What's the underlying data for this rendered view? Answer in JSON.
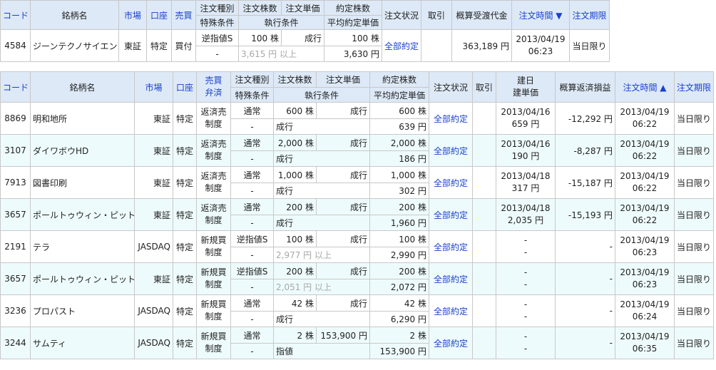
{
  "top": {
    "headers": {
      "code": "コード",
      "name": "銘柄名",
      "market": "市場",
      "account": "口座",
      "side": "売買",
      "order_type": "注文種別",
      "special": "特殊条件",
      "qty": "注文株数",
      "price": "注文単価",
      "exec_cond": "執行条件",
      "filled_qty": "約定株数",
      "avg_price": "平均約定単価",
      "status": "注文状況",
      "trade": "取引",
      "amount": "概算受渡代金",
      "order_time": "注文時間 ▼",
      "expiry": "注文期限"
    },
    "row": {
      "code": "4584",
      "name": "ジーンテクノサイエンス",
      "market": "東証",
      "account": "特定",
      "side": "買付",
      "order_type": "逆指値S",
      "special": "-",
      "qty": "100 株",
      "price": "成行",
      "exec": "3,615 円 以上",
      "filled_qty": "100 株",
      "avg_price": "3,630 円",
      "status": "全部約定",
      "trade": "",
      "amount": "363,189 円",
      "time1": "2013/04/19",
      "time2": "06:23",
      "expiry": "当日限り"
    }
  },
  "bottom": {
    "headers": {
      "code": "コード",
      "name": "銘柄名",
      "market": "市場",
      "account": "口座",
      "side1": "売買",
      "side2": "弁済",
      "order_type": "注文種別",
      "special": "特殊条件",
      "qty": "注文株数",
      "price": "注文単価",
      "exec_cond": "執行条件",
      "filled_qty": "約定株数",
      "avg_price": "平均約定単価",
      "status": "注文状況",
      "trade": "取引",
      "build1": "建日",
      "build2": "建単価",
      "pnl": "概算返済損益",
      "order_time": "注文時間 ▲",
      "expiry": "注文期限"
    },
    "rows": [
      {
        "code": "8869",
        "name": "明和地所",
        "market": "東証",
        "account": "特定",
        "side1": "返済売",
        "side2": "制度",
        "order_type": "通常",
        "special": "-",
        "qty": "600 株",
        "price": "成行",
        "exec": "成行",
        "exec_gray": false,
        "filled": "600 株",
        "avg": "639 円",
        "status": "全部約定",
        "build_date": "2013/04/16",
        "build_price": "659 円",
        "pnl": "-12,292 円",
        "time1": "2013/04/19",
        "time2": "06:22",
        "expiry": "当日限り"
      },
      {
        "code": "3107",
        "name": "ダイワボウHD",
        "market": "東証",
        "account": "特定",
        "side1": "返済売",
        "side2": "制度",
        "order_type": "通常",
        "special": "-",
        "qty": "2,000 株",
        "price": "成行",
        "exec": "成行",
        "exec_gray": false,
        "filled": "2,000 株",
        "avg": "186 円",
        "status": "全部約定",
        "build_date": "2013/04/16",
        "build_price": "190 円",
        "pnl": "-8,287 円",
        "time1": "2013/04/19",
        "time2": "06:22",
        "expiry": "当日限り"
      },
      {
        "code": "7913",
        "name": "図書印刷",
        "market": "東証",
        "account": "特定",
        "side1": "返済売",
        "side2": "制度",
        "order_type": "通常",
        "special": "-",
        "qty": "1,000 株",
        "price": "成行",
        "exec": "成行",
        "exec_gray": false,
        "filled": "1,000 株",
        "avg": "302 円",
        "status": "全部約定",
        "build_date": "2013/04/18",
        "build_price": "317 円",
        "pnl": "-15,187 円",
        "time1": "2013/04/19",
        "time2": "06:22",
        "expiry": "当日限り"
      },
      {
        "code": "3657",
        "name": "ポールトゥウィン・ピットクル",
        "market": "東証",
        "account": "特定",
        "side1": "返済売",
        "side2": "制度",
        "order_type": "通常",
        "special": "-",
        "qty": "200 株",
        "price": "成行",
        "exec": "成行",
        "exec_gray": false,
        "filled": "200 株",
        "avg": "1,960 円",
        "status": "全部約定",
        "build_date": "2013/04/18",
        "build_price": "2,035 円",
        "pnl": "-15,193 円",
        "time1": "2013/04/19",
        "time2": "06:22",
        "expiry": "当日限り"
      },
      {
        "code": "2191",
        "name": "テラ",
        "market": "JASDAQ",
        "account": "特定",
        "side1": "新規買",
        "side2": "制度",
        "order_type": "逆指値S",
        "special": "-",
        "qty": "100 株",
        "price": "成行",
        "exec": "2,977 円 以上",
        "exec_gray": true,
        "filled": "100 株",
        "avg": "2,990 円",
        "status": "全部約定",
        "build_date": "-",
        "build_price": "-",
        "pnl": "-",
        "time1": "2013/04/19",
        "time2": "06:23",
        "expiry": "当日限り"
      },
      {
        "code": "3657",
        "name": "ポールトゥウィン・ピットクル",
        "market": "東証",
        "account": "特定",
        "side1": "新規買",
        "side2": "制度",
        "order_type": "逆指値S",
        "special": "-",
        "qty": "200 株",
        "price": "成行",
        "exec": "2,051 円 以上",
        "exec_gray": true,
        "filled": "200 株",
        "avg": "2,072 円",
        "status": "全部約定",
        "build_date": "-",
        "build_price": "-",
        "pnl": "-",
        "time1": "2013/04/19",
        "time2": "06:23",
        "expiry": "当日限り"
      },
      {
        "code": "3236",
        "name": "プロパスト",
        "market": "JASDAQ",
        "account": "特定",
        "side1": "新規買",
        "side2": "制度",
        "order_type": "通常",
        "special": "-",
        "qty": "42 株",
        "price": "成行",
        "exec": "成行",
        "exec_gray": false,
        "filled": "42 株",
        "avg": "6,290 円",
        "status": "全部約定",
        "build_date": "-",
        "build_price": "-",
        "pnl": "-",
        "time1": "2013/04/19",
        "time2": "06:24",
        "expiry": "当日限り"
      },
      {
        "code": "3244",
        "name": "サムティ",
        "market": "JASDAQ",
        "account": "特定",
        "side1": "新規買",
        "side2": "制度",
        "order_type": "通常",
        "special": "-",
        "qty": "2 株",
        "price": "153,900 円",
        "exec": "指値",
        "exec_gray": false,
        "filled": "2 株",
        "avg": "153,900 円",
        "status": "全部約定",
        "build_date": "-",
        "build_price": "-",
        "pnl": "-",
        "time1": "2013/04/19",
        "time2": "06:35",
        "expiry": "当日限り"
      }
    ]
  }
}
